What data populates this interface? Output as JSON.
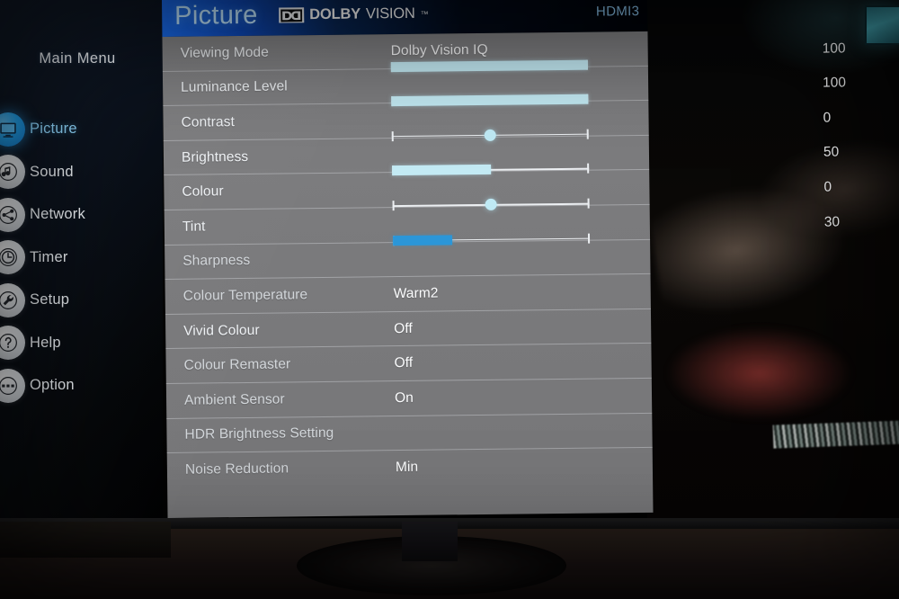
{
  "sidebar": {
    "title": "Main Menu",
    "items": [
      {
        "label": "Picture",
        "icon": "tv-icon",
        "active": true
      },
      {
        "label": "Sound",
        "icon": "music-note-icon",
        "active": false
      },
      {
        "label": "Network",
        "icon": "network-share-icon",
        "active": false
      },
      {
        "label": "Timer",
        "icon": "clock-icon",
        "active": false
      },
      {
        "label": "Setup",
        "icon": "wrench-icon",
        "active": false
      },
      {
        "label": "Help",
        "icon": "question-mark-icon",
        "active": false
      },
      {
        "label": "Option",
        "icon": "three-dots-icon",
        "active": false
      }
    ]
  },
  "header": {
    "title": "Picture",
    "logo_primary": "DOLBY",
    "logo_secondary": "VISION",
    "logo_tm": "™",
    "input_source": "HDMI3"
  },
  "colors": {
    "accent_blue": "#2b96d8",
    "bar_cyan": "#c3eaf4",
    "panel_grey": "#7b7b7d",
    "title_cyan": "#bfe6ff",
    "hdmi_blue": "#8cc6ef"
  },
  "menu": {
    "rows": [
      {
        "label": "Viewing Mode",
        "value": "Dolby Vision IQ",
        "type": "value"
      },
      {
        "label": "Luminance Level",
        "value": "100",
        "type": "bar",
        "percent": 100,
        "style": "cyan"
      },
      {
        "label": "Contrast",
        "value": "100",
        "type": "bar",
        "percent": 100,
        "style": "cyan"
      },
      {
        "label": "Brightness",
        "value": "0",
        "type": "knob",
        "percent": 50
      },
      {
        "label": "Colour",
        "value": "50",
        "type": "bar",
        "percent": 50,
        "style": "cyan"
      },
      {
        "label": "Tint",
        "value": "0",
        "type": "knob",
        "percent": 50
      },
      {
        "label": "Sharpness",
        "value": "30",
        "type": "bar",
        "percent": 30,
        "style": "accent"
      },
      {
        "label": "Colour Temperature",
        "value": "Warm2",
        "type": "value"
      },
      {
        "label": "Vivid Colour",
        "value": "Off",
        "type": "value"
      },
      {
        "label": "Colour Remaster",
        "value": "Off",
        "type": "value"
      },
      {
        "label": "Ambient Sensor",
        "value": "On",
        "type": "value"
      },
      {
        "label": "HDR Brightness Setting",
        "value": "",
        "type": "submenu"
      },
      {
        "label": "Noise Reduction",
        "value": "Min",
        "type": "value"
      }
    ]
  }
}
